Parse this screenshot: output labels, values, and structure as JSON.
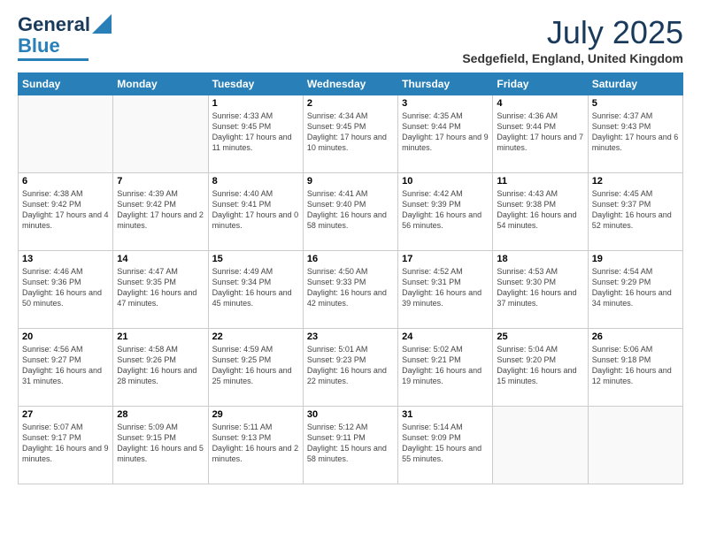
{
  "logo": {
    "part1": "General",
    "part2": "Blue"
  },
  "header": {
    "month_year": "July 2025",
    "location": "Sedgefield, England, United Kingdom"
  },
  "days_of_week": [
    "Sunday",
    "Monday",
    "Tuesday",
    "Wednesday",
    "Thursday",
    "Friday",
    "Saturday"
  ],
  "weeks": [
    [
      {
        "day": "",
        "info": ""
      },
      {
        "day": "",
        "info": ""
      },
      {
        "day": "1",
        "info": "Sunrise: 4:33 AM\nSunset: 9:45 PM\nDaylight: 17 hours and 11 minutes."
      },
      {
        "day": "2",
        "info": "Sunrise: 4:34 AM\nSunset: 9:45 PM\nDaylight: 17 hours and 10 minutes."
      },
      {
        "day": "3",
        "info": "Sunrise: 4:35 AM\nSunset: 9:44 PM\nDaylight: 17 hours and 9 minutes."
      },
      {
        "day": "4",
        "info": "Sunrise: 4:36 AM\nSunset: 9:44 PM\nDaylight: 17 hours and 7 minutes."
      },
      {
        "day": "5",
        "info": "Sunrise: 4:37 AM\nSunset: 9:43 PM\nDaylight: 17 hours and 6 minutes."
      }
    ],
    [
      {
        "day": "6",
        "info": "Sunrise: 4:38 AM\nSunset: 9:42 PM\nDaylight: 17 hours and 4 minutes."
      },
      {
        "day": "7",
        "info": "Sunrise: 4:39 AM\nSunset: 9:42 PM\nDaylight: 17 hours and 2 minutes."
      },
      {
        "day": "8",
        "info": "Sunrise: 4:40 AM\nSunset: 9:41 PM\nDaylight: 17 hours and 0 minutes."
      },
      {
        "day": "9",
        "info": "Sunrise: 4:41 AM\nSunset: 9:40 PM\nDaylight: 16 hours and 58 minutes."
      },
      {
        "day": "10",
        "info": "Sunrise: 4:42 AM\nSunset: 9:39 PM\nDaylight: 16 hours and 56 minutes."
      },
      {
        "day": "11",
        "info": "Sunrise: 4:43 AM\nSunset: 9:38 PM\nDaylight: 16 hours and 54 minutes."
      },
      {
        "day": "12",
        "info": "Sunrise: 4:45 AM\nSunset: 9:37 PM\nDaylight: 16 hours and 52 minutes."
      }
    ],
    [
      {
        "day": "13",
        "info": "Sunrise: 4:46 AM\nSunset: 9:36 PM\nDaylight: 16 hours and 50 minutes."
      },
      {
        "day": "14",
        "info": "Sunrise: 4:47 AM\nSunset: 9:35 PM\nDaylight: 16 hours and 47 minutes."
      },
      {
        "day": "15",
        "info": "Sunrise: 4:49 AM\nSunset: 9:34 PM\nDaylight: 16 hours and 45 minutes."
      },
      {
        "day": "16",
        "info": "Sunrise: 4:50 AM\nSunset: 9:33 PM\nDaylight: 16 hours and 42 minutes."
      },
      {
        "day": "17",
        "info": "Sunrise: 4:52 AM\nSunset: 9:31 PM\nDaylight: 16 hours and 39 minutes."
      },
      {
        "day": "18",
        "info": "Sunrise: 4:53 AM\nSunset: 9:30 PM\nDaylight: 16 hours and 37 minutes."
      },
      {
        "day": "19",
        "info": "Sunrise: 4:54 AM\nSunset: 9:29 PM\nDaylight: 16 hours and 34 minutes."
      }
    ],
    [
      {
        "day": "20",
        "info": "Sunrise: 4:56 AM\nSunset: 9:27 PM\nDaylight: 16 hours and 31 minutes."
      },
      {
        "day": "21",
        "info": "Sunrise: 4:58 AM\nSunset: 9:26 PM\nDaylight: 16 hours and 28 minutes."
      },
      {
        "day": "22",
        "info": "Sunrise: 4:59 AM\nSunset: 9:25 PM\nDaylight: 16 hours and 25 minutes."
      },
      {
        "day": "23",
        "info": "Sunrise: 5:01 AM\nSunset: 9:23 PM\nDaylight: 16 hours and 22 minutes."
      },
      {
        "day": "24",
        "info": "Sunrise: 5:02 AM\nSunset: 9:21 PM\nDaylight: 16 hours and 19 minutes."
      },
      {
        "day": "25",
        "info": "Sunrise: 5:04 AM\nSunset: 9:20 PM\nDaylight: 16 hours and 15 minutes."
      },
      {
        "day": "26",
        "info": "Sunrise: 5:06 AM\nSunset: 9:18 PM\nDaylight: 16 hours and 12 minutes."
      }
    ],
    [
      {
        "day": "27",
        "info": "Sunrise: 5:07 AM\nSunset: 9:17 PM\nDaylight: 16 hours and 9 minutes."
      },
      {
        "day": "28",
        "info": "Sunrise: 5:09 AM\nSunset: 9:15 PM\nDaylight: 16 hours and 5 minutes."
      },
      {
        "day": "29",
        "info": "Sunrise: 5:11 AM\nSunset: 9:13 PM\nDaylight: 16 hours and 2 minutes."
      },
      {
        "day": "30",
        "info": "Sunrise: 5:12 AM\nSunset: 9:11 PM\nDaylight: 15 hours and 58 minutes."
      },
      {
        "day": "31",
        "info": "Sunrise: 5:14 AM\nSunset: 9:09 PM\nDaylight: 15 hours and 55 minutes."
      },
      {
        "day": "",
        "info": ""
      },
      {
        "day": "",
        "info": ""
      }
    ]
  ]
}
